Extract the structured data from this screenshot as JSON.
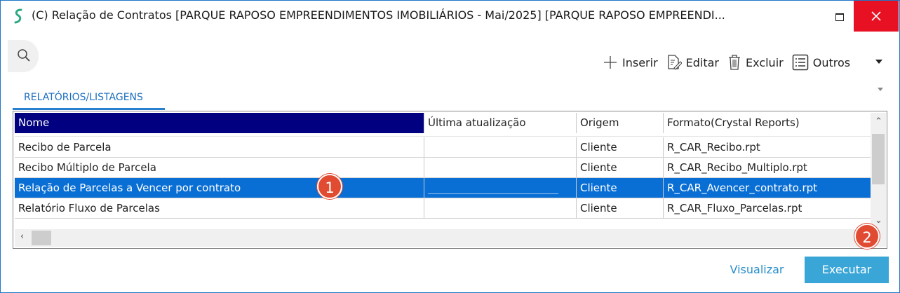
{
  "window": {
    "title": "(C) Relação de Contratos [PARQUE RAPOSO EMPREENDIMENTOS IMOBILIÁRIOS - Mai/2025]  [PARQUE RAPOSO EMPREENDI..."
  },
  "toolbar": {
    "inserir": "Inserir",
    "editar": "Editar",
    "excluir": "Excluir",
    "outros": "Outros"
  },
  "tab": {
    "label": "RELATÓRIOS/LISTAGENS"
  },
  "grid": {
    "columns": [
      "Nome",
      "Última atualização",
      "Origem",
      "Formato(Crystal Reports)"
    ],
    "rows": [
      {
        "nome": "Recibo de Parcela",
        "atualizacao": "",
        "origem": "Cliente",
        "formato": "R_CAR_Recibo.rpt"
      },
      {
        "nome": "Recibo Múltiplo de Parcela",
        "atualizacao": "",
        "origem": "Cliente",
        "formato": "R_CAR_Recibo_Multiplo.rpt"
      },
      {
        "nome": "Relação de Parcelas a Vencer por contrato",
        "atualizacao": "",
        "origem": "Cliente",
        "formato": "R_CAR_Avencer_contrato.rpt",
        "selected": true
      },
      {
        "nome": "Relatório Fluxo de Parcelas",
        "atualizacao": "",
        "origem": "Cliente",
        "formato": "R_CAR_Fluxo_Parcelas.rpt"
      }
    ]
  },
  "badges": [
    "1",
    "2"
  ],
  "buttons": {
    "visualizar": "Visualizar",
    "executar": "Executar"
  },
  "colors": {
    "accent": "#0a6fd4",
    "header_selected": "#000080",
    "close": "#e81123",
    "badge": "#e04b32",
    "executar": "#3aa6d8"
  }
}
